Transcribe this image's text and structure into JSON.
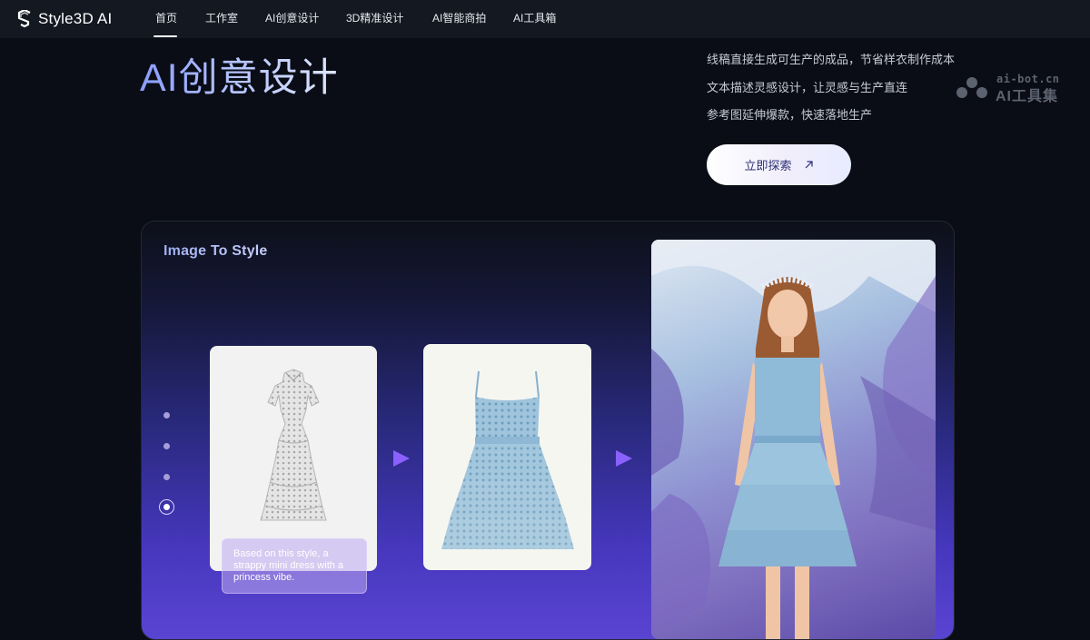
{
  "app": {
    "logo_text": "Style3D AI",
    "logo_icon": "style3d-s-logo-icon"
  },
  "nav": {
    "items": [
      {
        "label": "首页",
        "active": true
      },
      {
        "label": "工作室"
      },
      {
        "label": "AI创意设计"
      },
      {
        "label": "3D精准设计"
      },
      {
        "label": "AI智能商拍"
      },
      {
        "label": "AI工具箱"
      }
    ]
  },
  "hero": {
    "title": "AI创意设计",
    "features": [
      "线稿直接生成可生产的成品，节省样衣制作成本",
      "文本描述灵感设计，让灵感与生产直连",
      "参考图延伸爆款，快速落地生产"
    ],
    "cta_label": "立即探索",
    "cta_icon": "arrow-up-right-icon"
  },
  "watermark": {
    "url": "ai-bot.cn",
    "name": "AI工具集"
  },
  "showcase": {
    "title": "Image To Style",
    "pagination": {
      "total": 4,
      "active_index": 3
    },
    "prompt_text": "Based on this style, a strappy mini dress with a princess vibe.",
    "images": [
      "reference-lace-dress-image",
      "generated-blue-dress-image",
      "model-wearing-dress-image"
    ]
  },
  "colors": {
    "accent_title": "#8a9cff",
    "button_text": "#2b2f77",
    "panel_purple": "#5a44d2"
  }
}
